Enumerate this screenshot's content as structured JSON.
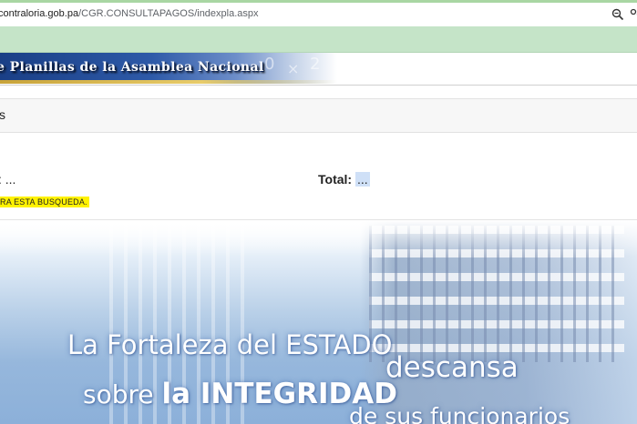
{
  "browser": {
    "url_domain": "contraloria.gob.pa",
    "url_path": "/CGR.CONSULTAPAGOS/indexpla.aspx",
    "zoom_icon": "zoom-icon",
    "share_icon": "share-icon"
  },
  "banner": {
    "title": "e Planillas de la Asamblea Nacional"
  },
  "section": {
    "label": "s"
  },
  "results": {
    "left_label": ": ...",
    "total_label": "Total:",
    "total_value": "..."
  },
  "alert": {
    "text": "RA ESTA BUSQUEDA."
  },
  "hero": {
    "line1": "La Fortaleza del ESTADO",
    "line2": "descansa",
    "line3_a": "sobre ",
    "line3_b": "la INTEGRIDAD",
    "line4": "de sus funcionarios"
  },
  "colors": {
    "banner_blue": "#1a3f86",
    "alert_yellow": "#fff200",
    "green_band": "#c5e4c8"
  }
}
